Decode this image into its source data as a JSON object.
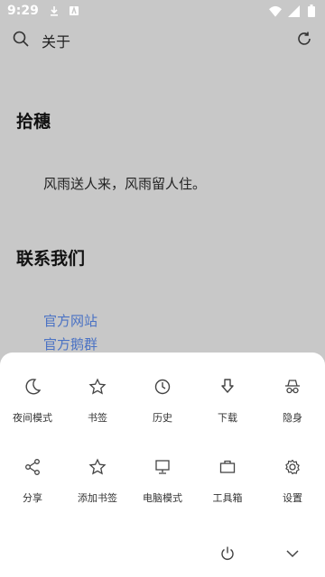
{
  "status": {
    "time": "9:29"
  },
  "header": {
    "title": "关于"
  },
  "content": {
    "heading1": "拾穗",
    "paragraph": "风雨送人来，风雨留人住。",
    "heading2": "联系我们",
    "links": [
      "官方网站",
      "官方鹅群"
    ]
  },
  "menu": {
    "row1": [
      "夜间模式",
      "书签",
      "历史",
      "下载",
      "隐身"
    ],
    "row2": [
      "分享",
      "添加书签",
      "电脑模式",
      "工具箱",
      "设置"
    ],
    "row1_icons": [
      "moon-icon",
      "star-icon",
      "clock-icon",
      "download-icon",
      "incognito-icon"
    ],
    "row2_icons": [
      "share-icon",
      "star-add-icon",
      "monitor-icon",
      "briefcase-icon",
      "gear-icon"
    ]
  }
}
